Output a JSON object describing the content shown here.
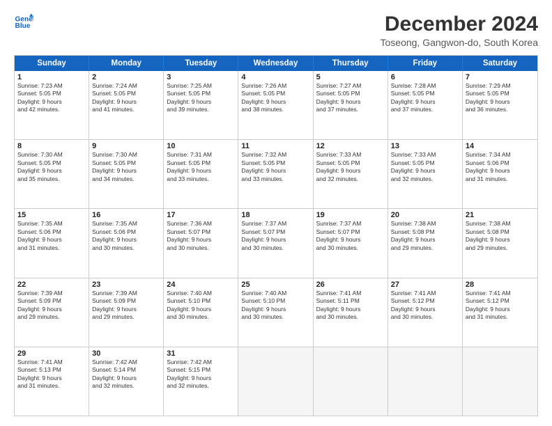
{
  "logo": {
    "line1": "General",
    "line2": "Blue"
  },
  "title": "December 2024",
  "subtitle": "Toseong, Gangwon-do, South Korea",
  "header_days": [
    "Sunday",
    "Monday",
    "Tuesday",
    "Wednesday",
    "Thursday",
    "Friday",
    "Saturday"
  ],
  "rows": [
    [
      {
        "day": "1",
        "lines": [
          "Sunrise: 7:23 AM",
          "Sunset: 5:05 PM",
          "Daylight: 9 hours",
          "and 42 minutes."
        ]
      },
      {
        "day": "2",
        "lines": [
          "Sunrise: 7:24 AM",
          "Sunset: 5:05 PM",
          "Daylight: 9 hours",
          "and 41 minutes."
        ]
      },
      {
        "day": "3",
        "lines": [
          "Sunrise: 7:25 AM",
          "Sunset: 5:05 PM",
          "Daylight: 9 hours",
          "and 39 minutes."
        ]
      },
      {
        "day": "4",
        "lines": [
          "Sunrise: 7:26 AM",
          "Sunset: 5:05 PM",
          "Daylight: 9 hours",
          "and 38 minutes."
        ]
      },
      {
        "day": "5",
        "lines": [
          "Sunrise: 7:27 AM",
          "Sunset: 5:05 PM",
          "Daylight: 9 hours",
          "and 37 minutes."
        ]
      },
      {
        "day": "6",
        "lines": [
          "Sunrise: 7:28 AM",
          "Sunset: 5:05 PM",
          "Daylight: 9 hours",
          "and 37 minutes."
        ]
      },
      {
        "day": "7",
        "lines": [
          "Sunrise: 7:29 AM",
          "Sunset: 5:05 PM",
          "Daylight: 9 hours",
          "and 36 minutes."
        ]
      }
    ],
    [
      {
        "day": "8",
        "lines": [
          "Sunrise: 7:30 AM",
          "Sunset: 5:05 PM",
          "Daylight: 9 hours",
          "and 35 minutes."
        ]
      },
      {
        "day": "9",
        "lines": [
          "Sunrise: 7:30 AM",
          "Sunset: 5:05 PM",
          "Daylight: 9 hours",
          "and 34 minutes."
        ]
      },
      {
        "day": "10",
        "lines": [
          "Sunrise: 7:31 AM",
          "Sunset: 5:05 PM",
          "Daylight: 9 hours",
          "and 33 minutes."
        ]
      },
      {
        "day": "11",
        "lines": [
          "Sunrise: 7:32 AM",
          "Sunset: 5:05 PM",
          "Daylight: 9 hours",
          "and 33 minutes."
        ]
      },
      {
        "day": "12",
        "lines": [
          "Sunrise: 7:33 AM",
          "Sunset: 5:05 PM",
          "Daylight: 9 hours",
          "and 32 minutes."
        ]
      },
      {
        "day": "13",
        "lines": [
          "Sunrise: 7:33 AM",
          "Sunset: 5:05 PM",
          "Daylight: 9 hours",
          "and 32 minutes."
        ]
      },
      {
        "day": "14",
        "lines": [
          "Sunrise: 7:34 AM",
          "Sunset: 5:06 PM",
          "Daylight: 9 hours",
          "and 31 minutes."
        ]
      }
    ],
    [
      {
        "day": "15",
        "lines": [
          "Sunrise: 7:35 AM",
          "Sunset: 5:06 PM",
          "Daylight: 9 hours",
          "and 31 minutes."
        ]
      },
      {
        "day": "16",
        "lines": [
          "Sunrise: 7:35 AM",
          "Sunset: 5:06 PM",
          "Daylight: 9 hours",
          "and 30 minutes."
        ]
      },
      {
        "day": "17",
        "lines": [
          "Sunrise: 7:36 AM",
          "Sunset: 5:07 PM",
          "Daylight: 9 hours",
          "and 30 minutes."
        ]
      },
      {
        "day": "18",
        "lines": [
          "Sunrise: 7:37 AM",
          "Sunset: 5:07 PM",
          "Daylight: 9 hours",
          "and 30 minutes."
        ]
      },
      {
        "day": "19",
        "lines": [
          "Sunrise: 7:37 AM",
          "Sunset: 5:07 PM",
          "Daylight: 9 hours",
          "and 30 minutes."
        ]
      },
      {
        "day": "20",
        "lines": [
          "Sunrise: 7:38 AM",
          "Sunset: 5:08 PM",
          "Daylight: 9 hours",
          "and 29 minutes."
        ]
      },
      {
        "day": "21",
        "lines": [
          "Sunrise: 7:38 AM",
          "Sunset: 5:08 PM",
          "Daylight: 9 hours",
          "and 29 minutes."
        ]
      }
    ],
    [
      {
        "day": "22",
        "lines": [
          "Sunrise: 7:39 AM",
          "Sunset: 5:09 PM",
          "Daylight: 9 hours",
          "and 29 minutes."
        ]
      },
      {
        "day": "23",
        "lines": [
          "Sunrise: 7:39 AM",
          "Sunset: 5:09 PM",
          "Daylight: 9 hours",
          "and 29 minutes."
        ]
      },
      {
        "day": "24",
        "lines": [
          "Sunrise: 7:40 AM",
          "Sunset: 5:10 PM",
          "Daylight: 9 hours",
          "and 30 minutes."
        ]
      },
      {
        "day": "25",
        "lines": [
          "Sunrise: 7:40 AM",
          "Sunset: 5:10 PM",
          "Daylight: 9 hours",
          "and 30 minutes."
        ]
      },
      {
        "day": "26",
        "lines": [
          "Sunrise: 7:41 AM",
          "Sunset: 5:11 PM",
          "Daylight: 9 hours",
          "and 30 minutes."
        ]
      },
      {
        "day": "27",
        "lines": [
          "Sunrise: 7:41 AM",
          "Sunset: 5:12 PM",
          "Daylight: 9 hours",
          "and 30 minutes."
        ]
      },
      {
        "day": "28",
        "lines": [
          "Sunrise: 7:41 AM",
          "Sunset: 5:12 PM",
          "Daylight: 9 hours",
          "and 31 minutes."
        ]
      }
    ],
    [
      {
        "day": "29",
        "lines": [
          "Sunrise: 7:41 AM",
          "Sunset: 5:13 PM",
          "Daylight: 9 hours",
          "and 31 minutes."
        ]
      },
      {
        "day": "30",
        "lines": [
          "Sunrise: 7:42 AM",
          "Sunset: 5:14 PM",
          "Daylight: 9 hours",
          "and 32 minutes."
        ]
      },
      {
        "day": "31",
        "lines": [
          "Sunrise: 7:42 AM",
          "Sunset: 5:15 PM",
          "Daylight: 9 hours",
          "and 32 minutes."
        ]
      },
      {
        "day": "",
        "lines": []
      },
      {
        "day": "",
        "lines": []
      },
      {
        "day": "",
        "lines": []
      },
      {
        "day": "",
        "lines": []
      }
    ]
  ]
}
